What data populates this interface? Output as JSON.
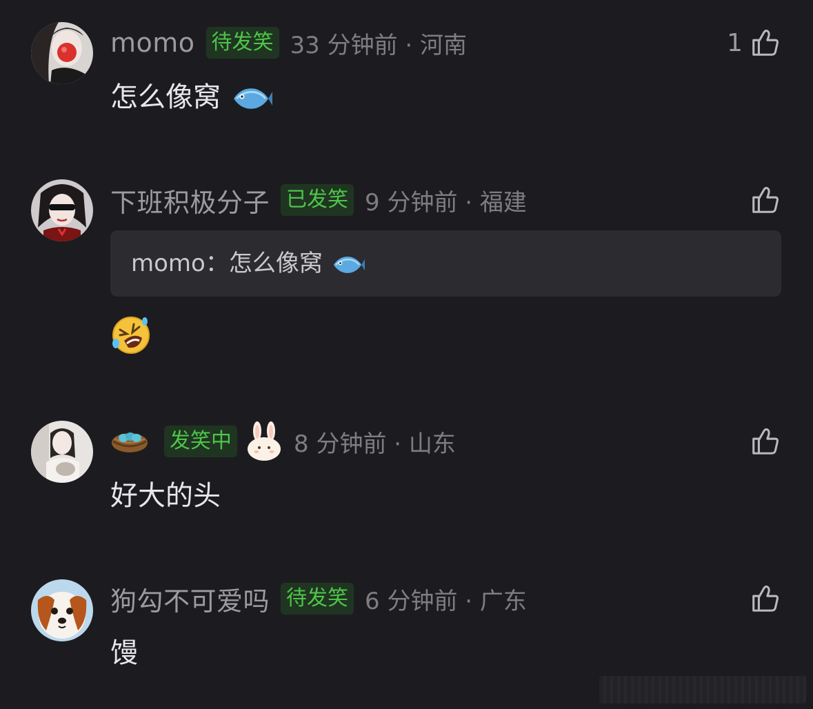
{
  "comments": [
    {
      "username": "momo",
      "badge": "待发笑",
      "meta": "33 分钟前 · 河南",
      "likes": "1",
      "text": "怎么像窝",
      "emoji_icon": "fish-icon"
    },
    {
      "username": "下班积极分子",
      "badge": "已发笑",
      "meta": "9 分钟前 · 福建",
      "likes": "",
      "quote_author": "momo：",
      "quote_text": "怎么像窝",
      "emoji_icon": "rolling-laughing-icon"
    },
    {
      "username_icon": "nest-with-eggs-icon",
      "badge": "发笑中",
      "badge_icon": "bunny-icon",
      "meta": "8 分钟前 · 山东",
      "likes": "",
      "text": "好大的头"
    },
    {
      "username": "狗勾不可爱吗",
      "badge": "待发笑",
      "meta": "6 分钟前 · 广东",
      "likes": "",
      "text": "馒"
    }
  ],
  "colors": {
    "background": "#1c1c20",
    "badge_green": "#4fc44a",
    "badge_bg": "#1f3521",
    "quote_bg": "#2b2b30"
  }
}
